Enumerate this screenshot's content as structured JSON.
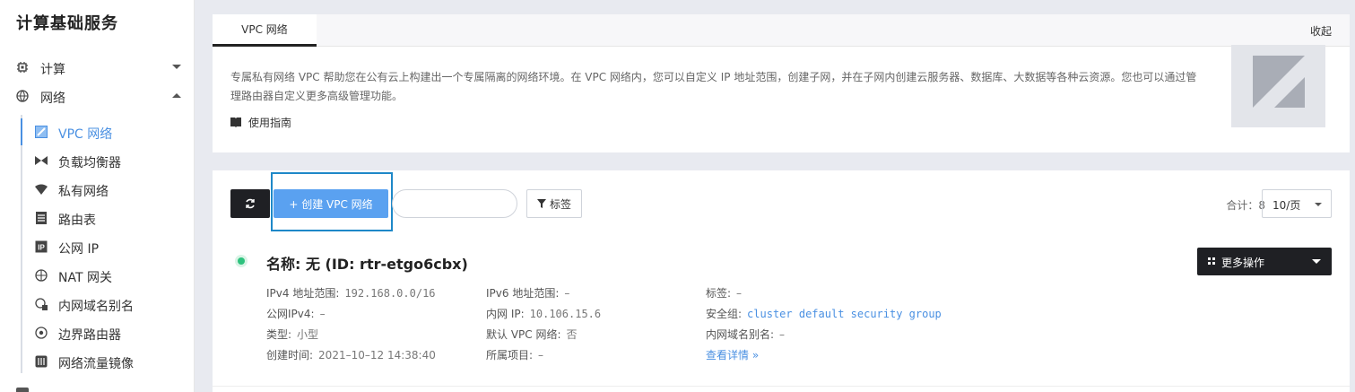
{
  "sidebar": {
    "title": "计算基础服务",
    "groups": [
      {
        "label": "计算",
        "icon": "chip-icon",
        "expanded": false
      },
      {
        "label": "网络",
        "icon": "globe-icon",
        "expanded": true
      }
    ],
    "items": [
      {
        "label": "VPC 网络",
        "icon": "vpc-icon",
        "active": true
      },
      {
        "label": "负载均衡器",
        "icon": "load-balancer-icon"
      },
      {
        "label": "私有网络",
        "icon": "wifi-icon"
      },
      {
        "label": "路由表",
        "icon": "route-table-icon"
      },
      {
        "label": "公网 IP",
        "icon": "ip-icon"
      },
      {
        "label": "NAT 网关",
        "icon": "nat-gateway-icon"
      },
      {
        "label": "内网域名别名",
        "icon": "dns-icon"
      },
      {
        "label": "边界路由器",
        "icon": "border-router-icon"
      },
      {
        "label": "网络流量镜像",
        "icon": "traffic-mirror-icon"
      }
    ]
  },
  "header": {
    "tab": "VPC 网络",
    "collapse_label": "收起",
    "description": "专属私有网络 VPC 帮助您在公有云上构建出一个专属隔离的网络环境。在 VPC 网络内，您可以自定义 IP 地址范围，创建子网，并在子网内创建云服务器、数据库、大数据等各种云资源。您也可以通过管理路由器自定义更多高级管理功能。",
    "guide_label": "使用指南"
  },
  "toolbar": {
    "create_label": "+ 创建 VPC 网络",
    "search_placeholder": "",
    "tag_label": "标签",
    "total_label": "合计：8",
    "page_size": "10/页"
  },
  "resource": {
    "name": "名称: 无 (ID: rtr-etgo6cbx)",
    "more_label": "更多操作",
    "fields": {
      "ipv4": {
        "k": "IPv4 地址范围:",
        "v": "192.168.0.0/16"
      },
      "public_ipv4": {
        "k": "公网IPv4:",
        "v": "–"
      },
      "type": {
        "k": "类型:",
        "v": "小型"
      },
      "created": {
        "k": "创建时间:",
        "v": "2021–10–12 14:38:40"
      },
      "ipv6": {
        "k": "IPv6 地址范围:",
        "v": "–"
      },
      "internal_ip": {
        "k": "内网 IP:",
        "v": "10.106.15.6"
      },
      "default_vpc": {
        "k": "默认 VPC 网络:",
        "v": "否"
      },
      "project": {
        "k": "所属项目:",
        "v": "–"
      },
      "tags": {
        "k": "标签:",
        "v": "–"
      },
      "security_group": {
        "k": "安全组:",
        "v": "cluster default security group"
      },
      "dns_alias": {
        "k": "内网域名别名:",
        "v": "–"
      }
    },
    "detail_link": "查看详情 »",
    "status_color": "#2ec27e"
  },
  "colors": {
    "accent": "#4a90e2",
    "primary_button": "#5aa1f0",
    "dark_button": "#1f2024",
    "highlight_border": "#1e88c8"
  }
}
